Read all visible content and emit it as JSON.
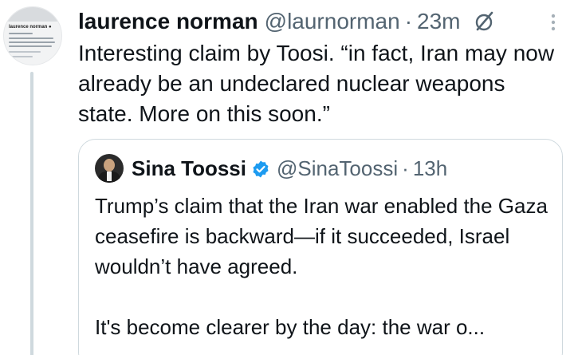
{
  "tweet": {
    "display_name": "laurence norman",
    "handle": "@laurnorman",
    "separator": "·",
    "time": "23m",
    "text": "Interesting claim by Toosi. “in fact, Iran may now already be an undeclared nuclear weapons state. More on this soon.”",
    "avatar_icon": "profile-card-screenshot",
    "action_icons": [
      "grok-icon",
      "more-options-icon"
    ]
  },
  "quote": {
    "display_name": "Sina Toossi",
    "verified": true,
    "handle": "@SinaToossi",
    "separator": "·",
    "time": "13h",
    "text_p1": "Trump’s claim that the Iran war enabled the Gaza ceasefire is backward—if it succeeded, Israel wouldn’t have agreed.",
    "text_p2": "It's become clearer by the day: the war o..."
  },
  "colors": {
    "text_primary": "#0f1419",
    "text_secondary": "#536471",
    "border": "#cfd9de",
    "verified_blue": "#1d9bf0"
  }
}
